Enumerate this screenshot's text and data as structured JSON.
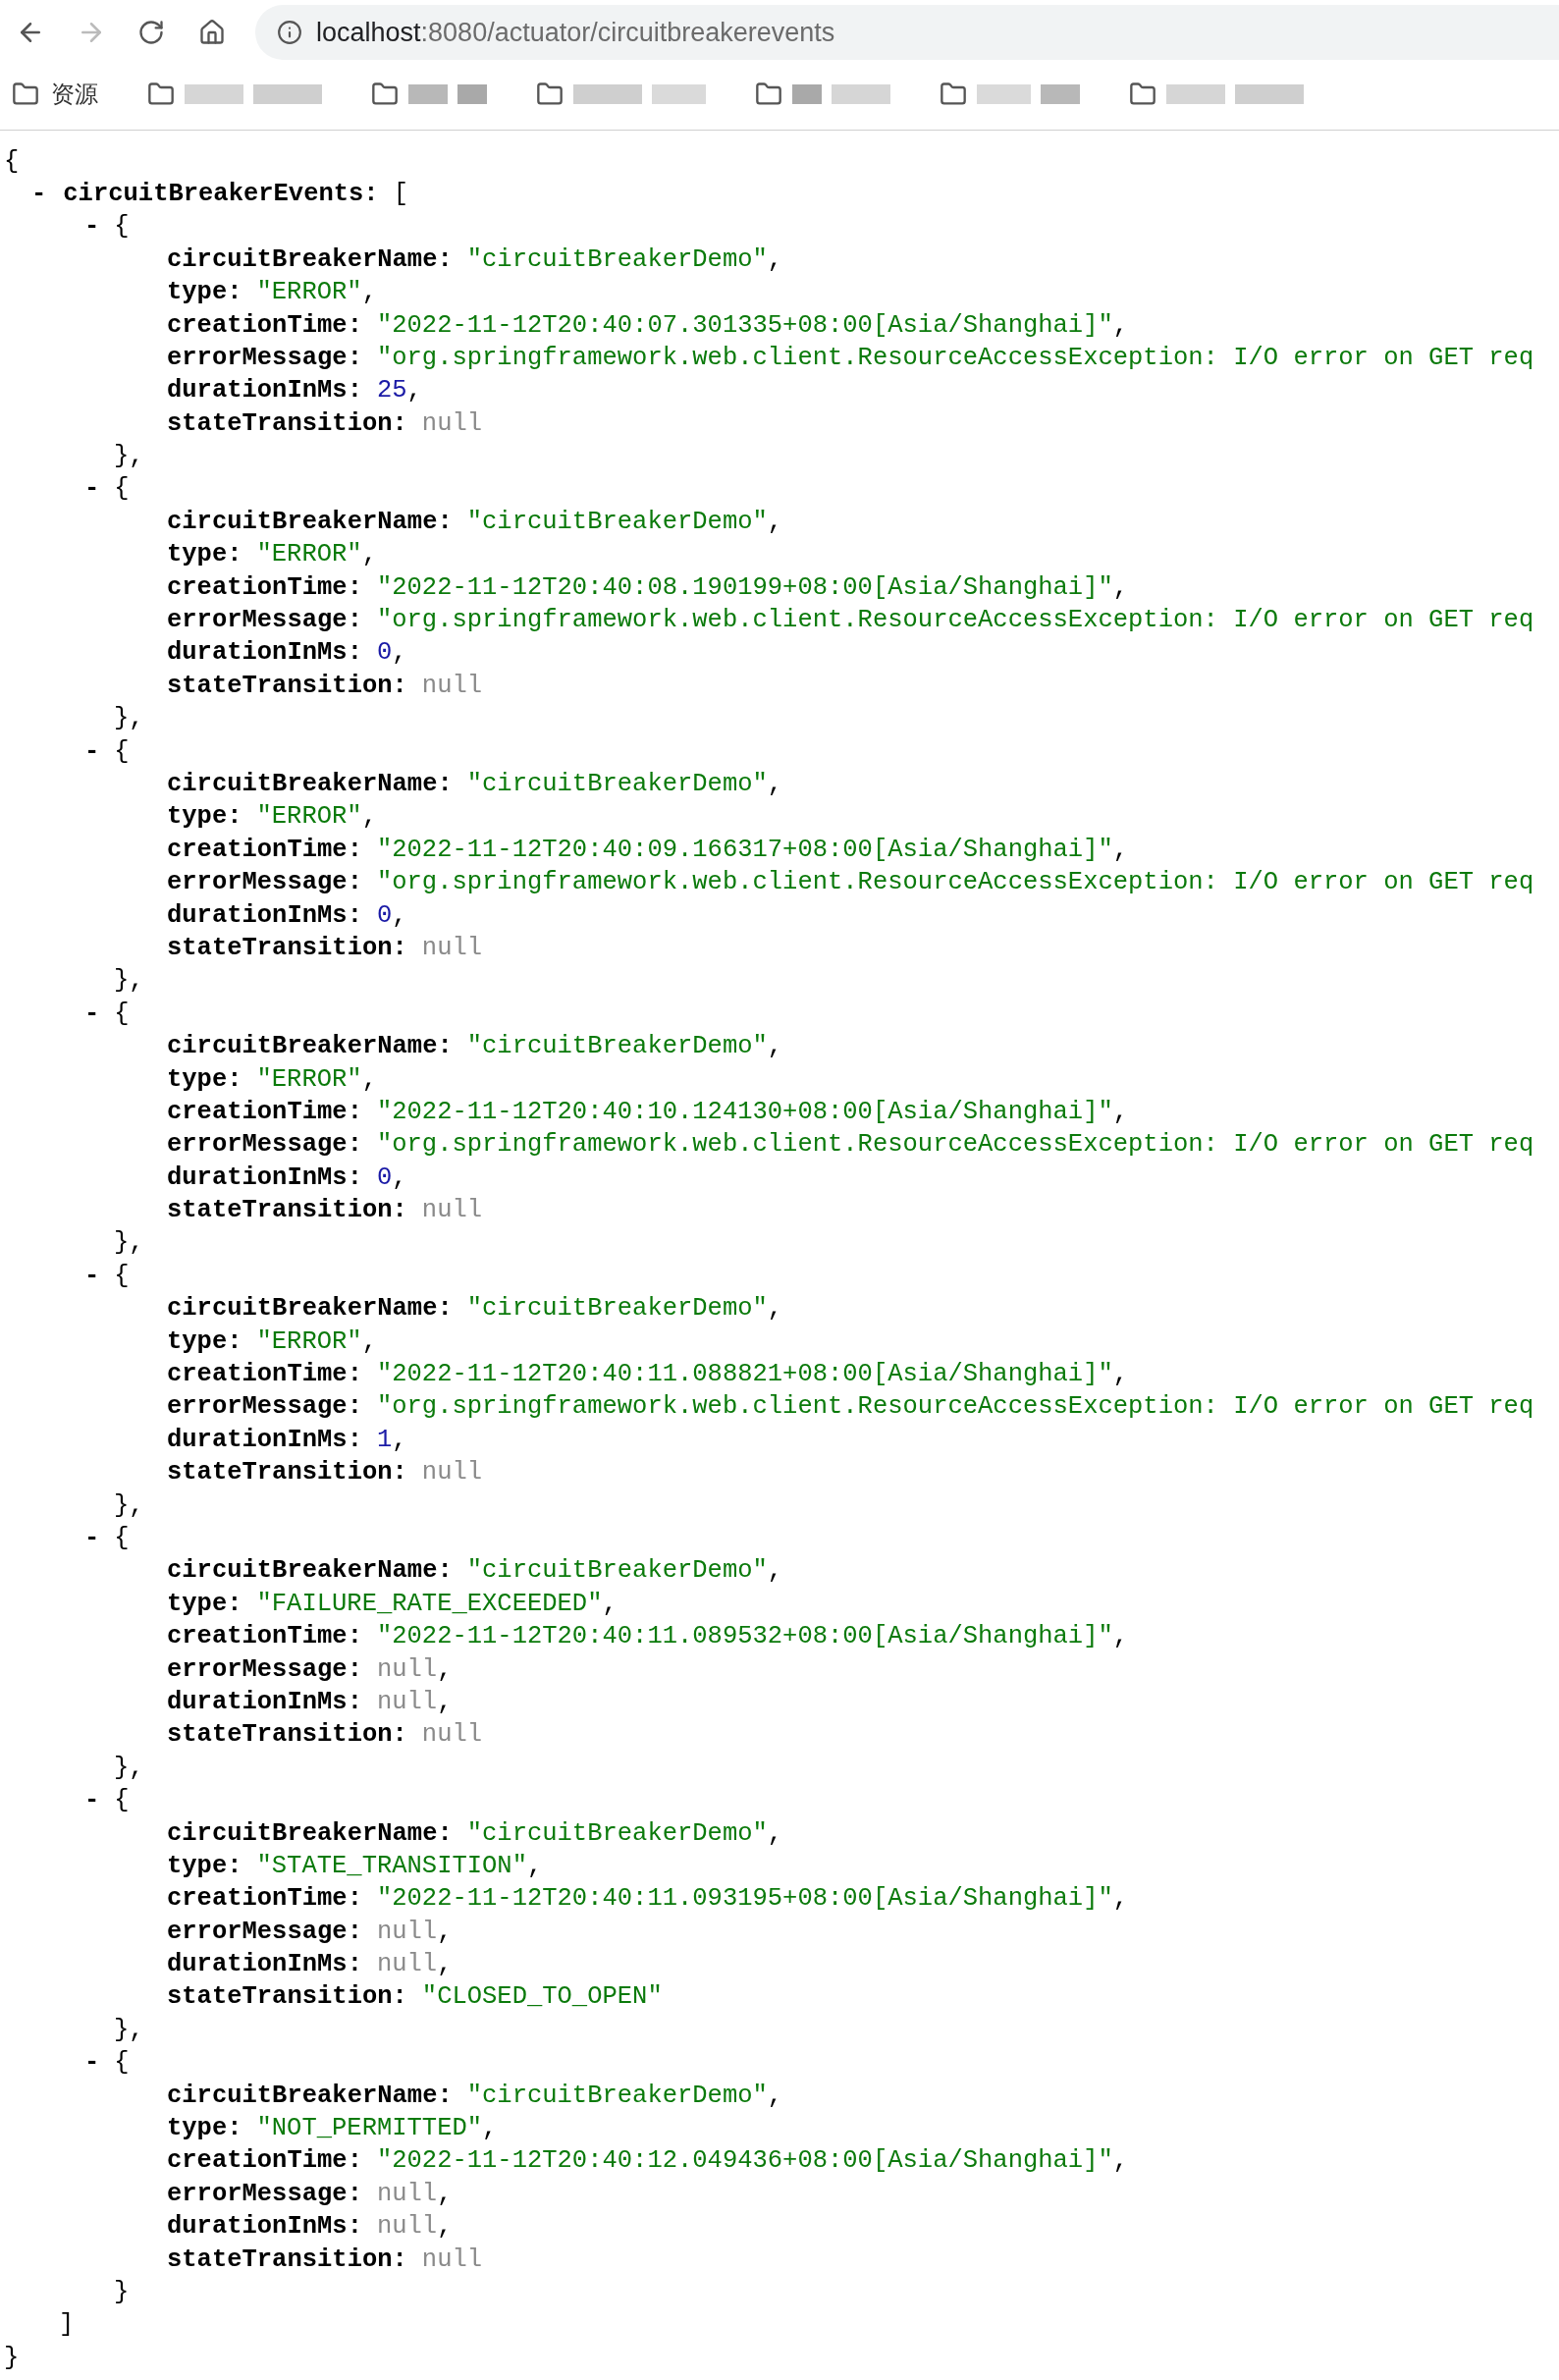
{
  "address_bar": {
    "host": "localhost",
    "path": ":8080/actuator/circuitbreakerevents"
  },
  "bookmarks": [
    {
      "label": "资源"
    }
  ],
  "json_view": {
    "open": "{",
    "root": {
      "toggle": "-",
      "key": "circuitBreakerEvents:",
      "bracket": "["
    },
    "events": [
      {
        "toggle": "-",
        "open": "{",
        "close": "},",
        "fields": [
          {
            "key": "circuitBreakerName:",
            "value": "\"circuitBreakerDemo\"",
            "kind": "string",
            "sep": ","
          },
          {
            "key": "type:",
            "value": "\"ERROR\"",
            "kind": "string",
            "sep": ","
          },
          {
            "key": "creationTime:",
            "value": "\"2022-11-12T20:40:07.301335+08:00[Asia/Shanghai]\"",
            "kind": "string",
            "sep": ","
          },
          {
            "key": "errorMessage:",
            "value": "\"org.springframework.web.client.ResourceAccessException: I/O error on GET req",
            "kind": "string"
          },
          {
            "key": "durationInMs:",
            "value": "25",
            "kind": "number",
            "sep": ","
          },
          {
            "key": "stateTransition:",
            "value": "null",
            "kind": "null"
          }
        ]
      },
      {
        "toggle": "-",
        "open": "{",
        "close": "},",
        "fields": [
          {
            "key": "circuitBreakerName:",
            "value": "\"circuitBreakerDemo\"",
            "kind": "string",
            "sep": ","
          },
          {
            "key": "type:",
            "value": "\"ERROR\"",
            "kind": "string",
            "sep": ","
          },
          {
            "key": "creationTime:",
            "value": "\"2022-11-12T20:40:08.190199+08:00[Asia/Shanghai]\"",
            "kind": "string",
            "sep": ","
          },
          {
            "key": "errorMessage:",
            "value": "\"org.springframework.web.client.ResourceAccessException: I/O error on GET req",
            "kind": "string"
          },
          {
            "key": "durationInMs:",
            "value": "0",
            "kind": "number",
            "sep": ","
          },
          {
            "key": "stateTransition:",
            "value": "null",
            "kind": "null"
          }
        ]
      },
      {
        "toggle": "-",
        "open": "{",
        "close": "},",
        "fields": [
          {
            "key": "circuitBreakerName:",
            "value": "\"circuitBreakerDemo\"",
            "kind": "string",
            "sep": ","
          },
          {
            "key": "type:",
            "value": "\"ERROR\"",
            "kind": "string",
            "sep": ","
          },
          {
            "key": "creationTime:",
            "value": "\"2022-11-12T20:40:09.166317+08:00[Asia/Shanghai]\"",
            "kind": "string",
            "sep": ","
          },
          {
            "key": "errorMessage:",
            "value": "\"org.springframework.web.client.ResourceAccessException: I/O error on GET req",
            "kind": "string"
          },
          {
            "key": "durationInMs:",
            "value": "0",
            "kind": "number",
            "sep": ","
          },
          {
            "key": "stateTransition:",
            "value": "null",
            "kind": "null"
          }
        ]
      },
      {
        "toggle": "-",
        "open": "{",
        "close": "},",
        "fields": [
          {
            "key": "circuitBreakerName:",
            "value": "\"circuitBreakerDemo\"",
            "kind": "string",
            "sep": ","
          },
          {
            "key": "type:",
            "value": "\"ERROR\"",
            "kind": "string",
            "sep": ","
          },
          {
            "key": "creationTime:",
            "value": "\"2022-11-12T20:40:10.124130+08:00[Asia/Shanghai]\"",
            "kind": "string",
            "sep": ","
          },
          {
            "key": "errorMessage:",
            "value": "\"org.springframework.web.client.ResourceAccessException: I/O error on GET req",
            "kind": "string"
          },
          {
            "key": "durationInMs:",
            "value": "0",
            "kind": "number",
            "sep": ","
          },
          {
            "key": "stateTransition:",
            "value": "null",
            "kind": "null"
          }
        ]
      },
      {
        "toggle": "-",
        "open": "{",
        "close": "},",
        "fields": [
          {
            "key": "circuitBreakerName:",
            "value": "\"circuitBreakerDemo\"",
            "kind": "string",
            "sep": ","
          },
          {
            "key": "type:",
            "value": "\"ERROR\"",
            "kind": "string",
            "sep": ","
          },
          {
            "key": "creationTime:",
            "value": "\"2022-11-12T20:40:11.088821+08:00[Asia/Shanghai]\"",
            "kind": "string",
            "sep": ","
          },
          {
            "key": "errorMessage:",
            "value": "\"org.springframework.web.client.ResourceAccessException: I/O error on GET req",
            "kind": "string"
          },
          {
            "key": "durationInMs:",
            "value": "1",
            "kind": "number",
            "sep": ","
          },
          {
            "key": "stateTransition:",
            "value": "null",
            "kind": "null"
          }
        ]
      },
      {
        "toggle": "-",
        "open": "{",
        "close": "},",
        "fields": [
          {
            "key": "circuitBreakerName:",
            "value": "\"circuitBreakerDemo\"",
            "kind": "string",
            "sep": ","
          },
          {
            "key": "type:",
            "value": "\"FAILURE_RATE_EXCEEDED\"",
            "kind": "string",
            "sep": ","
          },
          {
            "key": "creationTime:",
            "value": "\"2022-11-12T20:40:11.089532+08:00[Asia/Shanghai]\"",
            "kind": "string",
            "sep": ","
          },
          {
            "key": "errorMessage:",
            "value": "null",
            "kind": "null",
            "sep": ","
          },
          {
            "key": "durationInMs:",
            "value": "null",
            "kind": "null",
            "sep": ","
          },
          {
            "key": "stateTransition:",
            "value": "null",
            "kind": "null"
          }
        ]
      },
      {
        "toggle": "-",
        "open": "{",
        "close": "},",
        "fields": [
          {
            "key": "circuitBreakerName:",
            "value": "\"circuitBreakerDemo\"",
            "kind": "string",
            "sep": ","
          },
          {
            "key": "type:",
            "value": "\"STATE_TRANSITION\"",
            "kind": "string",
            "sep": ","
          },
          {
            "key": "creationTime:",
            "value": "\"2022-11-12T20:40:11.093195+08:00[Asia/Shanghai]\"",
            "kind": "string",
            "sep": ","
          },
          {
            "key": "errorMessage:",
            "value": "null",
            "kind": "null",
            "sep": ","
          },
          {
            "key": "durationInMs:",
            "value": "null",
            "kind": "null",
            "sep": ","
          },
          {
            "key": "stateTransition:",
            "value": "\"CLOSED_TO_OPEN\"",
            "kind": "string"
          }
        ]
      },
      {
        "toggle": "-",
        "open": "{",
        "close": "}",
        "fields": [
          {
            "key": "circuitBreakerName:",
            "value": "\"circuitBreakerDemo\"",
            "kind": "string",
            "sep": ","
          },
          {
            "key": "type:",
            "value": "\"NOT_PERMITTED\"",
            "kind": "string",
            "sep": ","
          },
          {
            "key": "creationTime:",
            "value": "\"2022-11-12T20:40:12.049436+08:00[Asia/Shanghai]\"",
            "kind": "string",
            "sep": ","
          },
          {
            "key": "errorMessage:",
            "value": "null",
            "kind": "null",
            "sep": ","
          },
          {
            "key": "durationInMs:",
            "value": "null",
            "kind": "null",
            "sep": ","
          },
          {
            "key": "stateTransition:",
            "value": "null",
            "kind": "null"
          }
        ]
      }
    ],
    "close_bracket": "]",
    "close": "}"
  }
}
